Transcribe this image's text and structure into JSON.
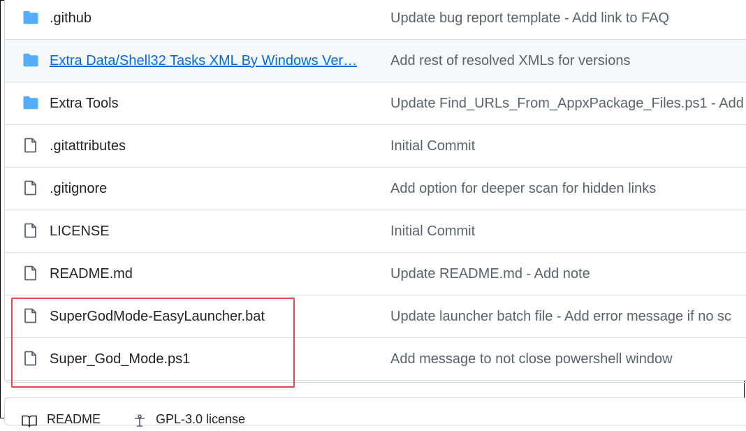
{
  "file_list": {
    "rows": [
      {
        "type": "folder",
        "icon": "folder-icon",
        "name": ".github",
        "message": "Update bug report template - Add link to FAQ"
      },
      {
        "type": "folder",
        "icon": "folder-icon",
        "name": "Extra Data/Shell32 Tasks XML By Windows Ver…",
        "message": "Add rest of resolved XMLs for versions"
      },
      {
        "type": "folder",
        "icon": "folder-icon",
        "name": "Extra Tools",
        "message": "Update Find_URLs_From_AppxPackage_Files.ps1 - Add"
      },
      {
        "type": "file",
        "icon": "file-icon",
        "name": ".gitattributes",
        "message": "Initial Commit"
      },
      {
        "type": "file",
        "icon": "file-icon",
        "name": ".gitignore",
        "message": "Add option for deeper scan for hidden links"
      },
      {
        "type": "file",
        "icon": "file-icon",
        "name": "LICENSE",
        "message": "Initial Commit"
      },
      {
        "type": "file",
        "icon": "file-icon",
        "name": "README.md",
        "message": "Update README.md - Add note"
      },
      {
        "type": "file",
        "icon": "file-icon",
        "name": "SuperGodMode-EasyLauncher.bat",
        "message": "Update launcher batch file - Add error message if no sc"
      },
      {
        "type": "file",
        "icon": "file-icon",
        "name": "Super_God_Mode.ps1",
        "message": "Add message to not close powershell window"
      }
    ]
  },
  "readme_bar": {
    "tab1_label": "README",
    "tab1_icon": "book-icon",
    "tab2_label": "GPL-3.0 license",
    "tab2_icon": "scale-icon"
  },
  "colors": {
    "folder": "#54aeff",
    "link": "#0969da",
    "highlight_border": "#e5484d",
    "message_text": "#59636e"
  }
}
